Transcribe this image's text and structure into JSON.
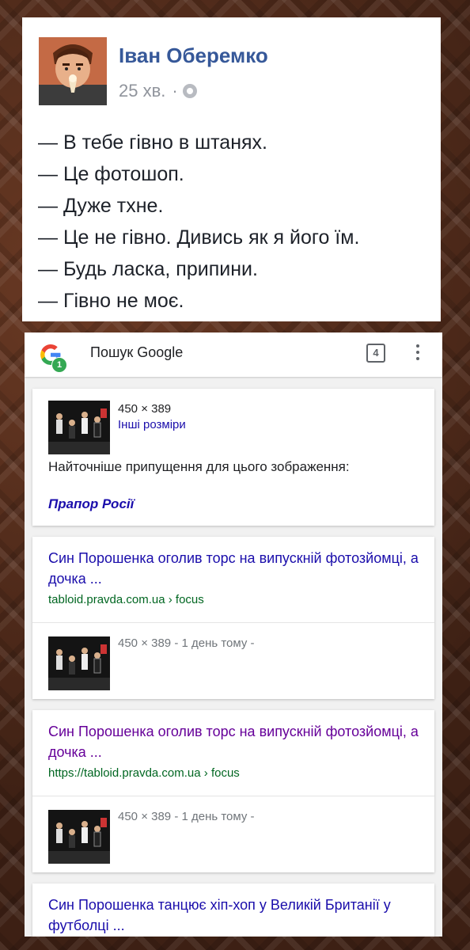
{
  "post": {
    "author": "Іван Оберемко",
    "time": "25 хв.",
    "separator": "·",
    "privacy_icon": "globe-icon",
    "lines": [
      "— В тебе гівно в штанях.",
      "— Це фотошоп.",
      "— Дуже тхне.",
      "— Це не гівно. Дивись як я його їм.",
      "— Будь ласка, припини.",
      "— Гівно не моє."
    ]
  },
  "google": {
    "header": {
      "title": "Пошук Google",
      "badge": "1",
      "tab_count": "4",
      "menu_icon": "more-vert-icon"
    },
    "image_card": {
      "dimensions": "450 × 389",
      "other_sizes": "Інші розміри",
      "best_guess_label": "Найточніше припущення для цього зображення:",
      "best_guess_link": "Прапор Росії"
    },
    "results": [
      {
        "title": "Син Порошенка оголив торс на випускній фотозйомці, а дочка ...",
        "url": "tabloid.pravda.com.ua › focus",
        "meta": "450 × 389 - 1 день тому -"
      },
      {
        "title": "Син Порошенка оголив торс на випускній фотозйомці, а дочка ...",
        "url": "https://tabloid.pravda.com.ua › focus",
        "meta": "450 × 389 - 1 день тому -"
      },
      {
        "title": "Син Порошенка танцює хіп-хоп у Великій Британії у футболці ..."
      }
    ]
  },
  "colors": {
    "fb_name": "#365899",
    "link_blue": "#1a0dab",
    "link_visited": "#660099",
    "url_green": "#006621",
    "background_brown": "#4a2a1c"
  }
}
